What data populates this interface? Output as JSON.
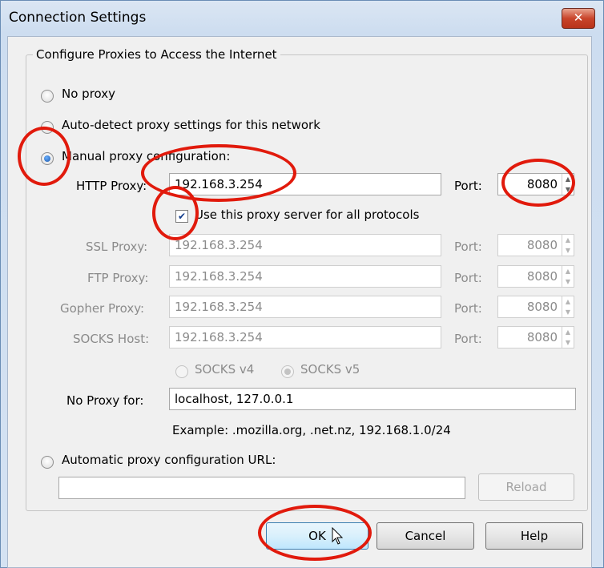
{
  "window": {
    "title": "Connection Settings",
    "close_glyph": "✕"
  },
  "group": {
    "legend": "Configure Proxies to Access the Internet"
  },
  "options": {
    "no_proxy": "No proxy",
    "auto_detect": "Auto-detect proxy settings for this network",
    "manual": "Manual proxy configuration:",
    "auto_url": "Automatic proxy configuration URL:"
  },
  "selected_option": "manual",
  "http": {
    "label": "HTTP Proxy:",
    "value": "192.168.3.254",
    "port_label": "Port:",
    "port": "8080"
  },
  "use_for_all": {
    "label": "Use this proxy server for all protocols",
    "checked": true
  },
  "ssl": {
    "label": "SSL Proxy:",
    "value": "192.168.3.254",
    "port_label": "Port:",
    "port": "8080"
  },
  "ftp": {
    "label": "FTP Proxy:",
    "value": "192.168.3.254",
    "port_label": "Port:",
    "port": "8080"
  },
  "gopher": {
    "label": "Gopher Proxy:",
    "value": "192.168.3.254",
    "port_label": "Port:",
    "port": "8080"
  },
  "socks": {
    "label": "SOCKS Host:",
    "value": "192.168.3.254",
    "port_label": "Port:",
    "port": "8080",
    "v4_label": "SOCKS v4",
    "v5_label": "SOCKS v5",
    "selected_version": "v5"
  },
  "no_proxy_for": {
    "label": "No Proxy for:",
    "value": "localhost, 127.0.0.1",
    "example": "Example: .mozilla.org, .net.nz, 192.168.1.0/24"
  },
  "auto_url": {
    "value": "",
    "reload_label": "Reload"
  },
  "buttons": {
    "ok": "OK",
    "cancel": "Cancel",
    "help": "Help"
  },
  "colors": {
    "annotation": "#e11a0c",
    "accent": "#3c7fb1"
  },
  "icons": {
    "checkmark": "✔",
    "spin_up": "▲",
    "spin_down": "▼"
  }
}
